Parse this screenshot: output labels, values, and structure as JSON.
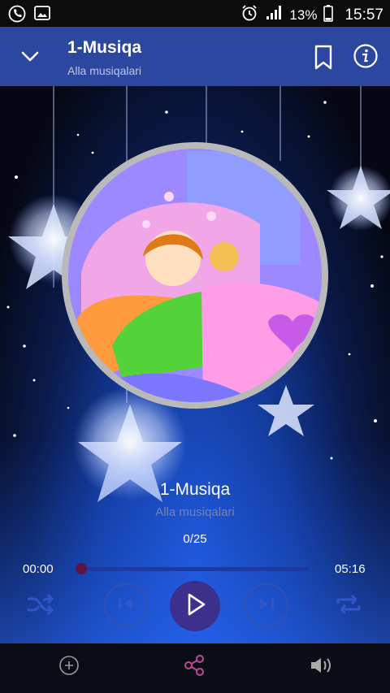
{
  "status": {
    "battery": "13%",
    "time": "15:57"
  },
  "header": {
    "title": "1-Musiqa",
    "subtitle": "Alla musiqalari"
  },
  "player": {
    "title": "1-Musiqa",
    "subtitle": "Alla musiqalari",
    "counter": "0/25",
    "elapsed": "00:00",
    "duration": "05:16",
    "progress": 0.0
  },
  "icons": {
    "header": [
      "chevron-down-icon",
      "bookmark-icon",
      "info-icon"
    ],
    "controls": [
      "shuffle-icon",
      "previous-icon",
      "play-icon",
      "next-icon",
      "repeat-icon"
    ],
    "bottom": [
      "add-icon",
      "share-icon",
      "volume-icon"
    ]
  }
}
